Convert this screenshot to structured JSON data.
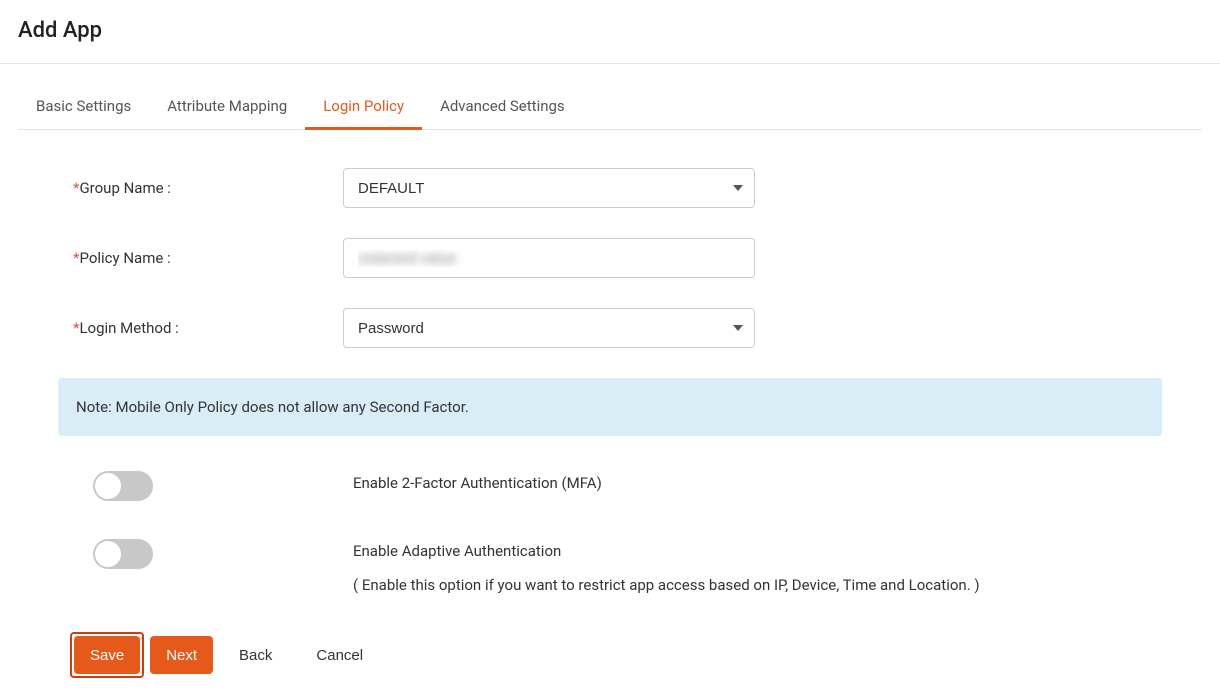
{
  "header": {
    "title": "Add App"
  },
  "tabs": [
    {
      "id": "basic",
      "label": "Basic Settings",
      "active": false
    },
    {
      "id": "attribute",
      "label": "Attribute Mapping",
      "active": false
    },
    {
      "id": "login",
      "label": "Login Policy",
      "active": true
    },
    {
      "id": "advanced",
      "label": "Advanced Settings",
      "active": false
    }
  ],
  "form": {
    "group_name": {
      "label": "Group Name :",
      "value": "DEFAULT"
    },
    "policy_name": {
      "label": "Policy Name :",
      "value": "redacted value"
    },
    "login_method": {
      "label": "Login Method :",
      "value": "Password"
    }
  },
  "note": "Note: Mobile Only Policy does not allow any Second Factor.",
  "toggles": {
    "mfa": {
      "label": "Enable 2-Factor Authentication (MFA)",
      "on": false
    },
    "adaptive": {
      "label": "Enable Adaptive Authentication",
      "sub": "( Enable this option if you want to restrict app access based on IP, Device, Time and Location. )",
      "on": false
    }
  },
  "buttons": {
    "save": "Save",
    "next": "Next",
    "back": "Back",
    "cancel": "Cancel"
  }
}
